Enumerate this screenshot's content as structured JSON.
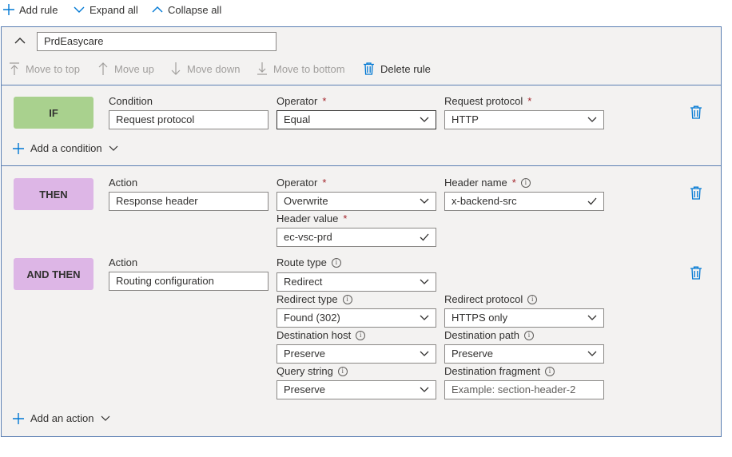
{
  "toolbar": {
    "add_rule": "Add rule",
    "expand_all": "Expand all",
    "collapse_all": "Collapse all"
  },
  "rule": {
    "name": "PrdEasycare",
    "actions": {
      "move_to_top": "Move to top",
      "move_up": "Move up",
      "move_down": "Move down",
      "move_to_bottom": "Move to bottom",
      "delete_rule": "Delete rule"
    },
    "condition": {
      "badge": "IF",
      "label": "Condition",
      "value": "Request protocol",
      "operator_label": "Operator",
      "operator_value": "Equal",
      "protocol_label": "Request protocol",
      "protocol_value": "HTTP",
      "add_condition": "Add a condition"
    },
    "then_action": {
      "badge": "THEN",
      "label": "Action",
      "value": "Response header",
      "operator_label": "Operator",
      "operator_value": "Overwrite",
      "header_name_label": "Header name",
      "header_name_value": "x-backend-src",
      "header_value_label": "Header value",
      "header_value_value": "ec-vsc-prd"
    },
    "and_then_action": {
      "badge": "AND THEN",
      "label": "Action",
      "value": "Routing configuration",
      "route_type_label": "Route type",
      "route_type_value": "Redirect",
      "redirect_type_label": "Redirect type",
      "redirect_type_value": "Found (302)",
      "redirect_protocol_label": "Redirect protocol",
      "redirect_protocol_value": "HTTPS only",
      "dest_host_label": "Destination host",
      "dest_host_value": "Preserve",
      "dest_path_label": "Destination path",
      "dest_path_value": "Preserve",
      "query_string_label": "Query string",
      "query_string_value": "Preserve",
      "dest_fragment_label": "Destination fragment",
      "dest_fragment_placeholder": "Example: section-header-2"
    },
    "add_action": "Add an action"
  },
  "colors": {
    "accent": "#0078d4",
    "if_badge": "#a9d18e",
    "then_badge": "#ddb6e6",
    "panel_bg": "#f3f2f1",
    "panel_border": "#5b7fb3",
    "required": "#a4262c"
  }
}
